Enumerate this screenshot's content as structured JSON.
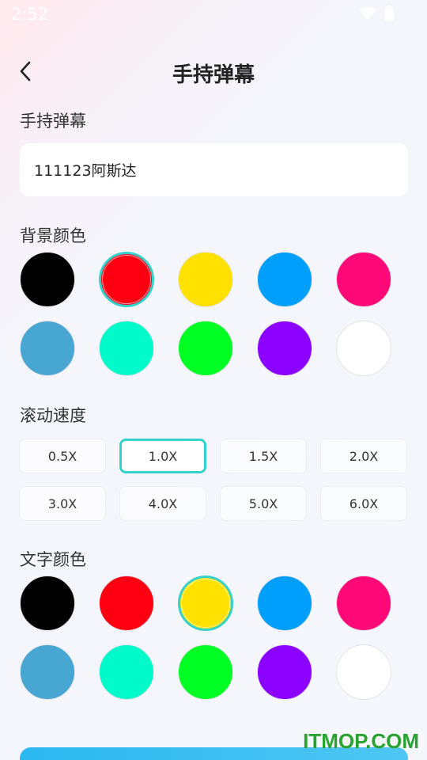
{
  "status_bar": {
    "time": "2:52"
  },
  "header": {
    "title": "手持弹幕"
  },
  "text_section": {
    "label": "手持弹幕",
    "value": "111123阿斯达"
  },
  "background_color": {
    "label": "背景颜色",
    "selected_index": 1,
    "colors": [
      "#000000",
      "#ff0012",
      "#ffe100",
      "#009ffb",
      "#ff0877",
      "#48a6d2",
      "#01fac9",
      "#00ff22",
      "#8b00ff",
      "#ffffff"
    ]
  },
  "scroll_speed": {
    "label": "滚动速度",
    "selected_index": 1,
    "options": [
      "0.5X",
      "1.0X",
      "1.5X",
      "2.0X",
      "3.0X",
      "4.0X",
      "5.0X",
      "6.0X"
    ]
  },
  "text_color": {
    "label": "文字颜色",
    "selected_index": 2,
    "colors": [
      "#000000",
      "#ff0012",
      "#ffe100",
      "#009ffb",
      "#ff0877",
      "#48a6d2",
      "#01fac9",
      "#00ff22",
      "#8b00ff",
      "#ffffff"
    ]
  },
  "accent_color": "#34d2cc",
  "watermark": "ITMOP.COM"
}
